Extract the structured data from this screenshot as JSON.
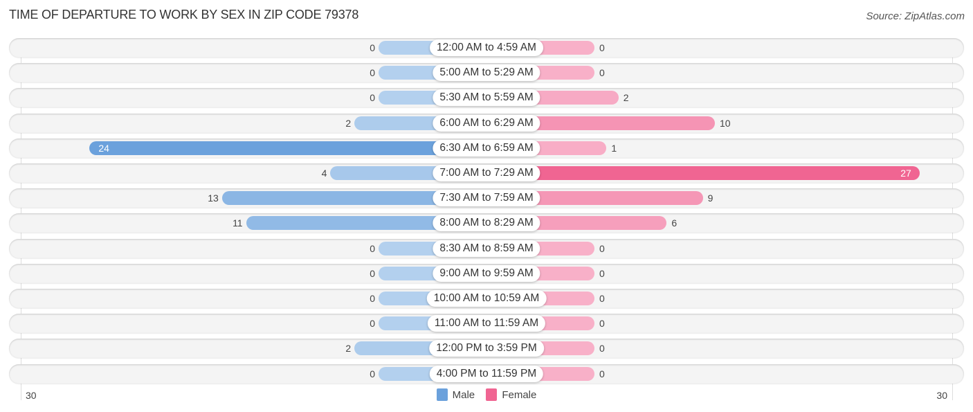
{
  "chart_data": {
    "type": "bar",
    "orientation": "horizontal-diverging",
    "title": "TIME OF DEPARTURE TO WORK BY SEX IN ZIP CODE 79378",
    "source": "Source: ZipAtlas.com",
    "categories": [
      "12:00 AM to 4:59 AM",
      "5:00 AM to 5:29 AM",
      "5:30 AM to 5:59 AM",
      "6:00 AM to 6:29 AM",
      "6:30 AM to 6:59 AM",
      "7:00 AM to 7:29 AM",
      "7:30 AM to 7:59 AM",
      "8:00 AM to 8:29 AM",
      "8:30 AM to 8:59 AM",
      "9:00 AM to 9:59 AM",
      "10:00 AM to 10:59 AM",
      "11:00 AM to 11:59 AM",
      "12:00 PM to 3:59 PM",
      "4:00 PM to 11:59 PM"
    ],
    "series": [
      {
        "name": "Male",
        "color": "#6ba1dc",
        "values": [
          0,
          0,
          0,
          2,
          24,
          4,
          13,
          11,
          0,
          0,
          0,
          0,
          2,
          0
        ]
      },
      {
        "name": "Female",
        "color": "#f06592",
        "values": [
          0,
          0,
          2,
          10,
          1,
          27,
          9,
          6,
          0,
          0,
          0,
          0,
          0,
          0
        ]
      }
    ],
    "axis": {
      "left_max_label": "30",
      "right_max_label": "30",
      "range": [
        -30,
        30
      ]
    },
    "legend": {
      "position": "bottom-center",
      "items": [
        "Male",
        "Female"
      ]
    }
  }
}
